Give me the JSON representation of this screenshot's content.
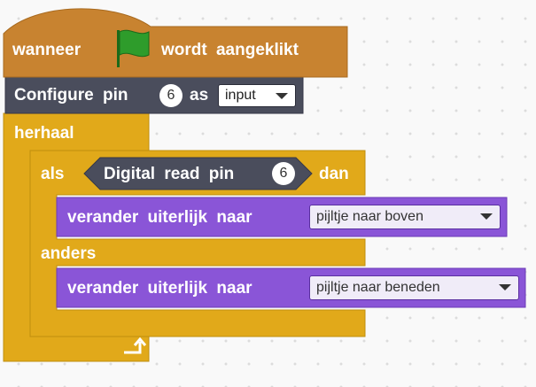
{
  "colors": {
    "events": "#c88330",
    "control": "#e1a91a",
    "hardware": "#4a4d5c",
    "looks": "#8a55d7",
    "flag": "#2e9c2b"
  },
  "icons": {
    "flag": "green-flag-icon",
    "loop_arrow": "loop-arrow-icon",
    "dropdown": "caret-down-icon"
  },
  "hat": {
    "before": "wanneer",
    "after": "wordt aangeklikt"
  },
  "configure": {
    "label": "Configure pin",
    "pin": "6",
    "as": "as",
    "mode": "input"
  },
  "loop": {
    "label": "herhaal"
  },
  "ifelse": {
    "if_label": "als",
    "then_label": "dan",
    "else_label": "anders",
    "condition": {
      "label": "Digital read pin",
      "pin": "6"
    }
  },
  "looks1": {
    "label": "verander uiterlijk naar",
    "costume": "pijltje naar boven"
  },
  "looks2": {
    "label": "verander uiterlijk naar",
    "costume": "pijltje naar beneden"
  }
}
